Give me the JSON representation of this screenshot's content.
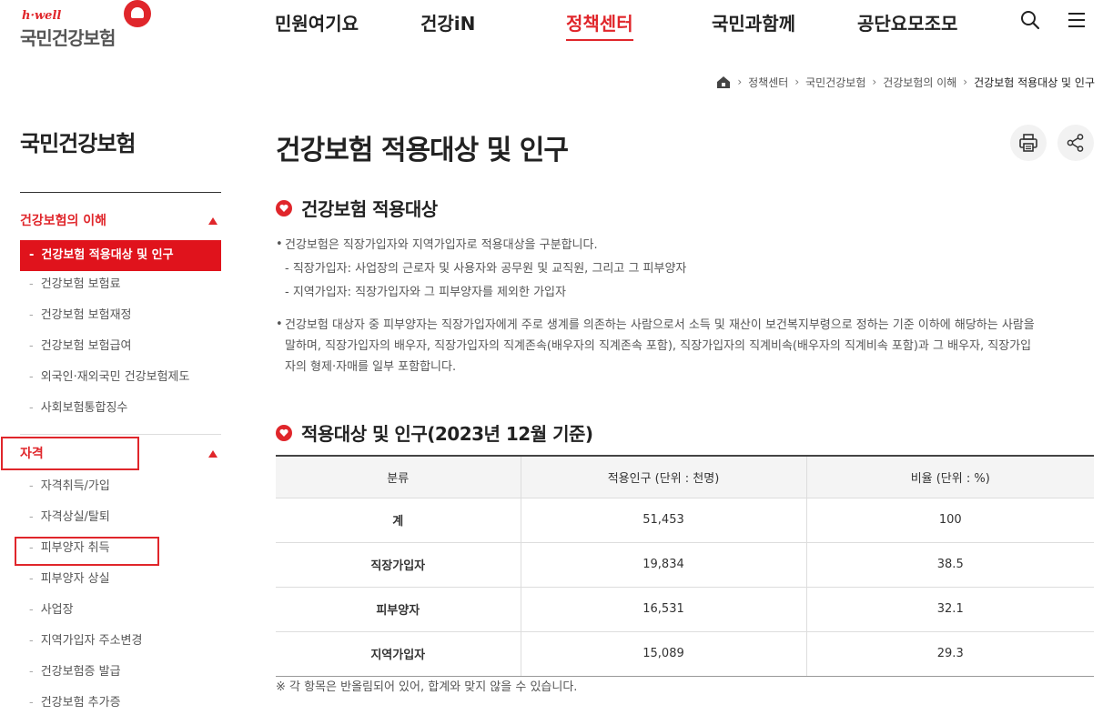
{
  "header": {
    "logo_tagline": "h·well",
    "logo_name": "국민건강보험",
    "nav": [
      "민원여기요",
      "건강iN",
      "정책센터",
      "국민과함께",
      "공단요모조모"
    ],
    "active_nav": 2,
    "accent_color": "#e0262b"
  },
  "breadcrumb": [
    "정책센터",
    "국민건강보험",
    "건강보험의 이해",
    "건강보험 적용대상 및 인구"
  ],
  "sidebar": {
    "title": "국민건강보험",
    "section1": {
      "label": "건강보험의 이해",
      "items": [
        "건강보험 적용대상 및 인구",
        "건강보험 보험료",
        "건강보험 보험재정",
        "건강보험 보험급여",
        "외국인·재외국민 건강보험제도",
        "사회보험통합징수"
      ]
    },
    "section2": {
      "label": "자격",
      "items": [
        "자격취득/가입",
        "자격상실/탈퇴",
        "피부양자 취득",
        "피부양자 상실",
        "사업장",
        "지역가입자 주소변경",
        "건강보험증 발급",
        "건강보험 추가증"
      ]
    }
  },
  "main": {
    "title": "건강보험 적용대상 및 인구",
    "section1": {
      "title": "건강보험 적용대상",
      "p1": "건강보험은 직장가입자와 지역가입자로 적용대상을 구분합니다.",
      "p1_sub1": "직장가입자: 사업장의 근로자 및 사용자와 공무원 및 교직원, 그리고 그 피부양자",
      "p1_sub2": "지역가입자: 직장가입자와 그 피부양자를 제외한 가입자",
      "p2_line1": "건강보험 대상자 중 피부양자는 직장가입자에게 주로 생계를 의존하는 사람으로서 소득 및 재산이 보건복지부령으로 정하는 기준 이하에 해당하는 사람을",
      "p2_line2": "말하며, 직장가입자의 배우자, 직장가입자의 직계존속(배우자의 직계존속 포함), 직장가입자의 직계비속(배우자의 직계비속 포함)과 그 배우자, 직장가입",
      "p2_line3": "자의 형제·자매를 일부 포함합니다."
    },
    "section2": {
      "title": "적용대상 및 인구(2023년 12월 기준)",
      "table": {
        "headers": [
          "분류",
          "적용인구 (단위 : 천명)",
          "비율 (단위 : %)"
        ],
        "rows": [
          [
            "계",
            "51,453",
            "100"
          ],
          [
            "직장가입자",
            "19,834",
            "38.5"
          ],
          [
            "피부양자",
            "16,531",
            "32.1"
          ],
          [
            "지역가입자",
            "15,089",
            "29.3"
          ]
        ]
      },
      "note": "※ 각 항목은 반올림되어 있어, 합계와 맞지 않을 수 있습니다."
    }
  }
}
